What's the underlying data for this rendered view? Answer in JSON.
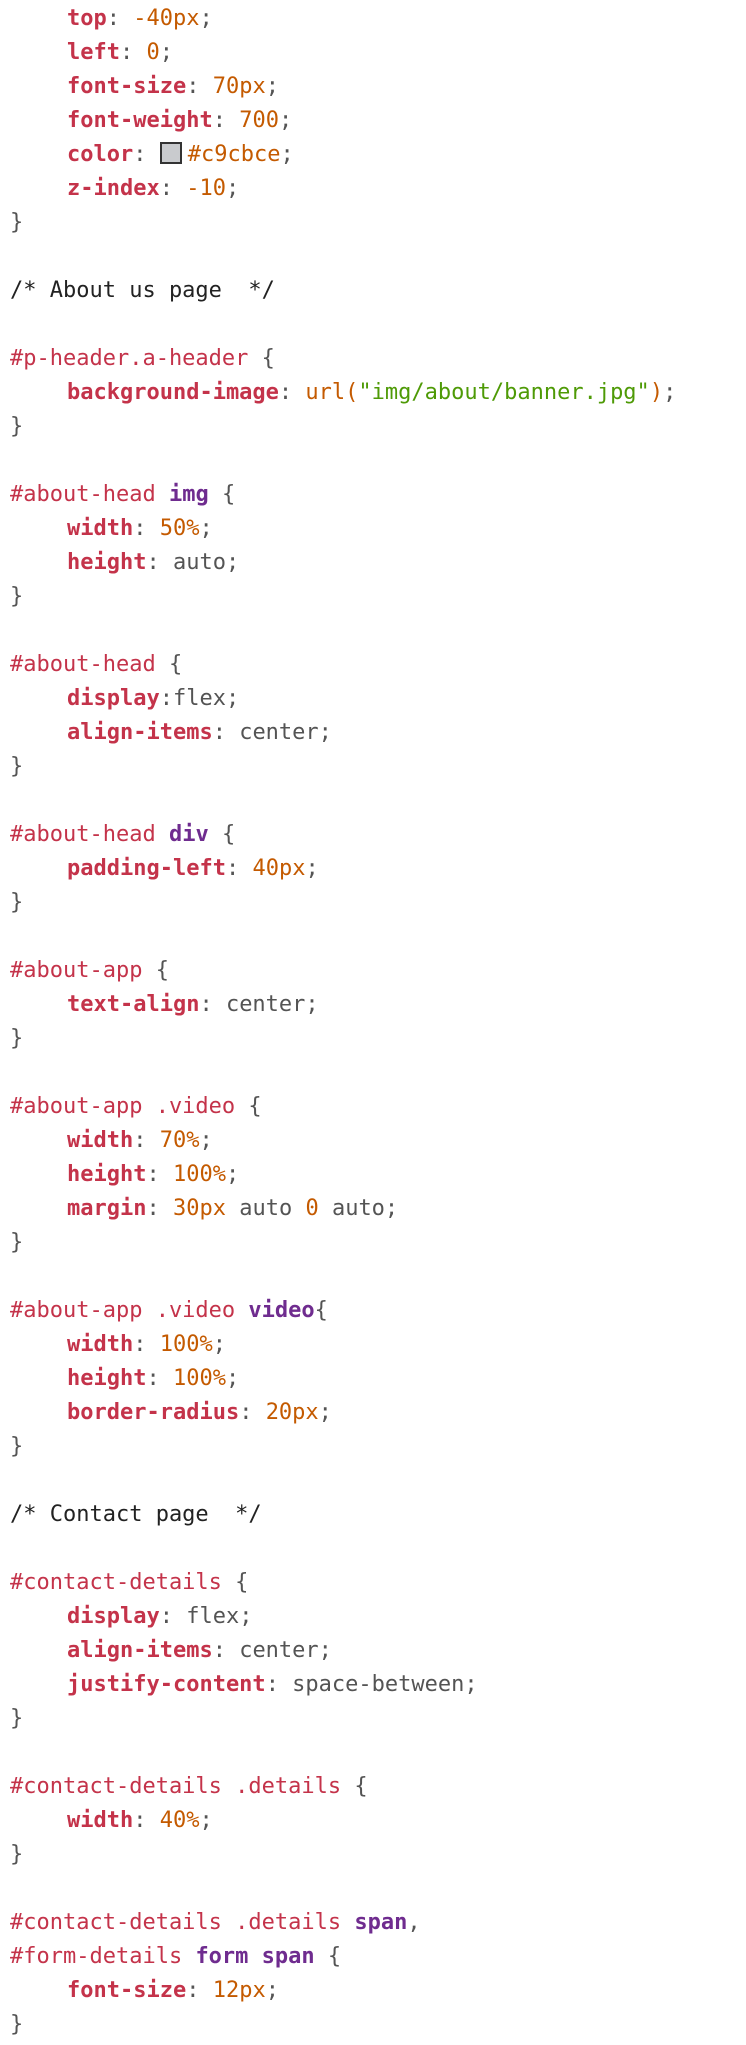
{
  "swatch_color": "#c9cbce",
  "lines": [
    [
      {
        "t": "indent"
      },
      {
        "c": "prop",
        "v": "top"
      },
      {
        "c": "plain",
        "v": ": "
      },
      {
        "c": "num",
        "v": "-40px"
      },
      {
        "c": "plain",
        "v": ";"
      }
    ],
    [
      {
        "t": "indent"
      },
      {
        "c": "prop",
        "v": "left"
      },
      {
        "c": "plain",
        "v": ": "
      },
      {
        "c": "num",
        "v": "0"
      },
      {
        "c": "plain",
        "v": ";"
      }
    ],
    [
      {
        "t": "indent"
      },
      {
        "c": "prop",
        "v": "font-size"
      },
      {
        "c": "plain",
        "v": ": "
      },
      {
        "c": "num",
        "v": "70px"
      },
      {
        "c": "plain",
        "v": ";"
      }
    ],
    [
      {
        "t": "indent"
      },
      {
        "c": "prop",
        "v": "font-weight"
      },
      {
        "c": "plain",
        "v": ": "
      },
      {
        "c": "num",
        "v": "700"
      },
      {
        "c": "plain",
        "v": ";"
      }
    ],
    [
      {
        "t": "indent"
      },
      {
        "c": "prop",
        "v": "color"
      },
      {
        "c": "plain",
        "v": ": "
      },
      {
        "t": "swatch"
      },
      {
        "c": "num",
        "v": "#c9cbce"
      },
      {
        "c": "plain",
        "v": ";"
      }
    ],
    [
      {
        "t": "indent"
      },
      {
        "c": "prop",
        "v": "z-index"
      },
      {
        "c": "plain",
        "v": ": "
      },
      {
        "c": "num",
        "v": "-10"
      },
      {
        "c": "plain",
        "v": ";"
      }
    ],
    [
      {
        "c": "plain",
        "v": "}"
      }
    ],
    [],
    [
      {
        "c": "cm",
        "v": "/* About us page  */"
      }
    ],
    [],
    [
      {
        "c": "sel",
        "v": "#p-header.a-header"
      },
      {
        "c": "plain",
        "v": " {"
      }
    ],
    [
      {
        "t": "indent"
      },
      {
        "c": "prop",
        "v": "background-image"
      },
      {
        "c": "plain",
        "v": ": "
      },
      {
        "c": "fn",
        "v": "url("
      },
      {
        "c": "str",
        "v": "\"img/about/banner.jpg\""
      },
      {
        "c": "fn",
        "v": ")"
      },
      {
        "c": "plain",
        "v": ";"
      }
    ],
    [
      {
        "c": "plain",
        "v": "}"
      }
    ],
    [],
    [
      {
        "c": "sel",
        "v": "#about-head "
      },
      {
        "c": "tag",
        "v": "img"
      },
      {
        "c": "plain",
        "v": " {"
      }
    ],
    [
      {
        "t": "indent"
      },
      {
        "c": "prop",
        "v": "width"
      },
      {
        "c": "plain",
        "v": ": "
      },
      {
        "c": "num",
        "v": "50%"
      },
      {
        "c": "plain",
        "v": ";"
      }
    ],
    [
      {
        "t": "indent"
      },
      {
        "c": "prop",
        "v": "height"
      },
      {
        "c": "plain",
        "v": ": auto;"
      }
    ],
    [
      {
        "c": "plain",
        "v": "}"
      }
    ],
    [],
    [
      {
        "c": "sel",
        "v": "#about-head"
      },
      {
        "c": "plain",
        "v": " {"
      }
    ],
    [
      {
        "t": "indent"
      },
      {
        "c": "prop",
        "v": "display"
      },
      {
        "c": "plain",
        "v": ":flex;"
      }
    ],
    [
      {
        "t": "indent"
      },
      {
        "c": "prop",
        "v": "align-items"
      },
      {
        "c": "plain",
        "v": ": center;"
      }
    ],
    [
      {
        "c": "plain",
        "v": "}"
      }
    ],
    [],
    [
      {
        "c": "sel",
        "v": "#about-head "
      },
      {
        "c": "tag",
        "v": "div"
      },
      {
        "c": "plain",
        "v": " {"
      }
    ],
    [
      {
        "t": "indent"
      },
      {
        "c": "prop",
        "v": "padding-left"
      },
      {
        "c": "plain",
        "v": ": "
      },
      {
        "c": "num",
        "v": "40px"
      },
      {
        "c": "plain",
        "v": ";"
      }
    ],
    [
      {
        "c": "plain",
        "v": "}"
      }
    ],
    [],
    [
      {
        "c": "sel",
        "v": "#about-app"
      },
      {
        "c": "plain",
        "v": " {"
      }
    ],
    [
      {
        "t": "indent"
      },
      {
        "c": "prop",
        "v": "text-align"
      },
      {
        "c": "plain",
        "v": ": center;"
      }
    ],
    [
      {
        "c": "plain",
        "v": "}"
      }
    ],
    [],
    [
      {
        "c": "sel",
        "v": "#about-app .video"
      },
      {
        "c": "plain",
        "v": " {"
      }
    ],
    [
      {
        "t": "indent"
      },
      {
        "c": "prop",
        "v": "width"
      },
      {
        "c": "plain",
        "v": ": "
      },
      {
        "c": "num",
        "v": "70%"
      },
      {
        "c": "plain",
        "v": ";"
      }
    ],
    [
      {
        "t": "indent"
      },
      {
        "c": "prop",
        "v": "height"
      },
      {
        "c": "plain",
        "v": ": "
      },
      {
        "c": "num",
        "v": "100%"
      },
      {
        "c": "plain",
        "v": ";"
      }
    ],
    [
      {
        "t": "indent"
      },
      {
        "c": "prop",
        "v": "margin"
      },
      {
        "c": "plain",
        "v": ": "
      },
      {
        "c": "num",
        "v": "30px"
      },
      {
        "c": "plain",
        "v": " auto "
      },
      {
        "c": "num",
        "v": "0"
      },
      {
        "c": "plain",
        "v": " auto;"
      }
    ],
    [
      {
        "c": "plain",
        "v": "}"
      }
    ],
    [],
    [
      {
        "c": "sel",
        "v": "#about-app .video "
      },
      {
        "c": "tag",
        "v": "video"
      },
      {
        "c": "plain",
        "v": "{"
      }
    ],
    [
      {
        "t": "indent"
      },
      {
        "c": "prop",
        "v": "width"
      },
      {
        "c": "plain",
        "v": ": "
      },
      {
        "c": "num",
        "v": "100%"
      },
      {
        "c": "plain",
        "v": ";"
      }
    ],
    [
      {
        "t": "indent"
      },
      {
        "c": "prop",
        "v": "height"
      },
      {
        "c": "plain",
        "v": ": "
      },
      {
        "c": "num",
        "v": "100%"
      },
      {
        "c": "plain",
        "v": ";"
      }
    ],
    [
      {
        "t": "indent"
      },
      {
        "c": "prop",
        "v": "border-radius"
      },
      {
        "c": "plain",
        "v": ": "
      },
      {
        "c": "num",
        "v": "20px"
      },
      {
        "c": "plain",
        "v": ";"
      }
    ],
    [
      {
        "c": "plain",
        "v": "}"
      }
    ],
    [],
    [
      {
        "c": "cm",
        "v": "/* Contact page  */"
      }
    ],
    [],
    [
      {
        "c": "sel",
        "v": "#contact-details"
      },
      {
        "c": "plain",
        "v": " {"
      }
    ],
    [
      {
        "t": "indent"
      },
      {
        "c": "prop",
        "v": "display"
      },
      {
        "c": "plain",
        "v": ": flex;"
      }
    ],
    [
      {
        "t": "indent"
      },
      {
        "c": "prop",
        "v": "align-items"
      },
      {
        "c": "plain",
        "v": ": center;"
      }
    ],
    [
      {
        "t": "indent"
      },
      {
        "c": "prop",
        "v": "justify-content"
      },
      {
        "c": "plain",
        "v": ": space-between;"
      }
    ],
    [
      {
        "c": "plain",
        "v": "}"
      }
    ],
    [],
    [
      {
        "c": "sel",
        "v": "#contact-details .details"
      },
      {
        "c": "plain",
        "v": " {"
      }
    ],
    [
      {
        "t": "indent"
      },
      {
        "c": "prop",
        "v": "width"
      },
      {
        "c": "plain",
        "v": ": "
      },
      {
        "c": "num",
        "v": "40%"
      },
      {
        "c": "plain",
        "v": ";"
      }
    ],
    [
      {
        "c": "plain",
        "v": "}"
      }
    ],
    [],
    [
      {
        "c": "sel",
        "v": "#contact-details .details "
      },
      {
        "c": "tag",
        "v": "span"
      },
      {
        "c": "plain",
        "v": ","
      }
    ],
    [
      {
        "c": "sel",
        "v": "#form-details "
      },
      {
        "c": "tag",
        "v": "form"
      },
      {
        "c": "plain",
        "v": " "
      },
      {
        "c": "tag",
        "v": "span"
      },
      {
        "c": "plain",
        "v": " {"
      }
    ],
    [
      {
        "t": "indent"
      },
      {
        "c": "prop",
        "v": "font-size"
      },
      {
        "c": "plain",
        "v": ": "
      },
      {
        "c": "num",
        "v": "12px"
      },
      {
        "c": "plain",
        "v": ";"
      }
    ],
    [
      {
        "c": "plain",
        "v": "}"
      }
    ]
  ]
}
